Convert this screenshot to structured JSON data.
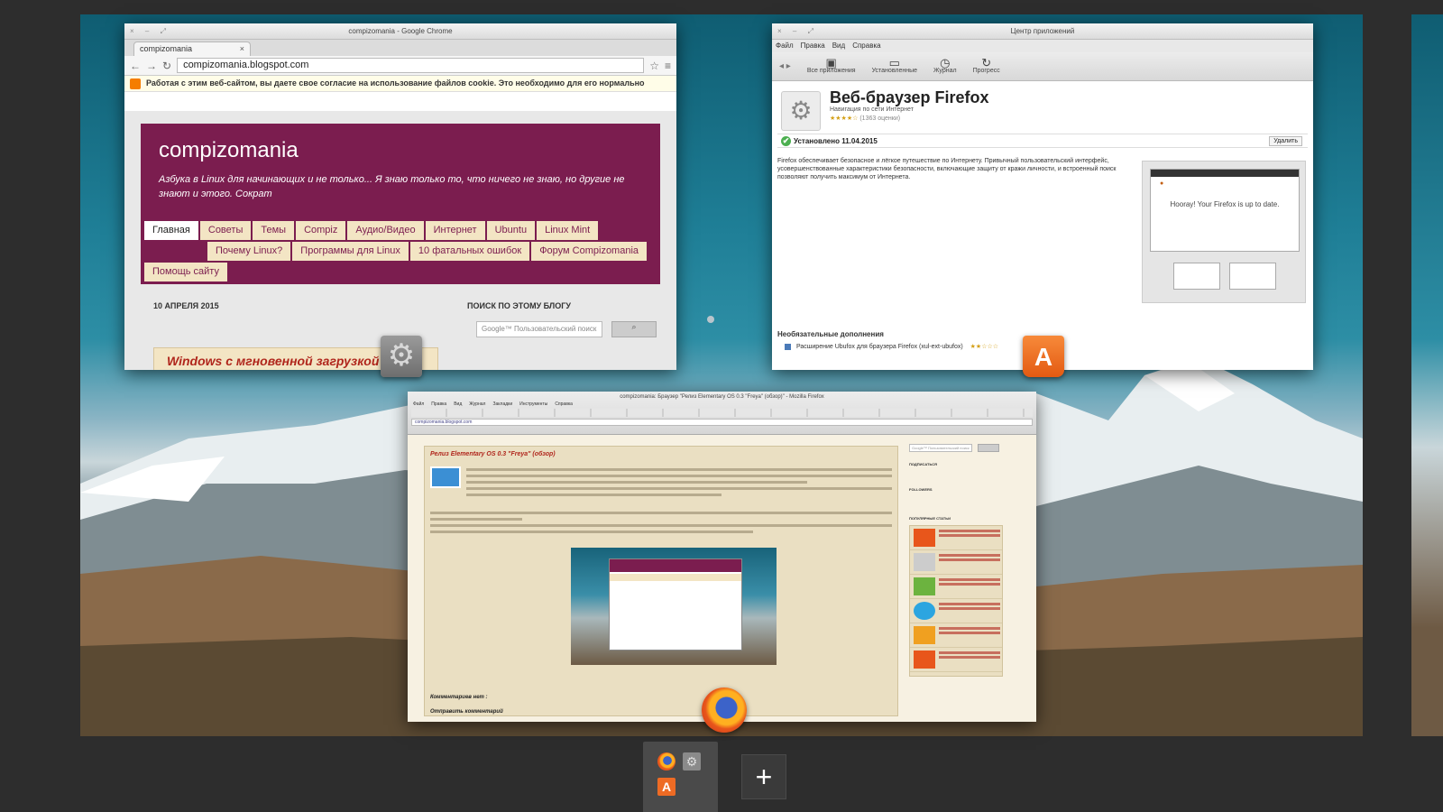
{
  "chrome": {
    "window_title": "compizomania - Google Chrome",
    "tab_label": "compizomania",
    "tab_close": "×",
    "url": "compizomania.blogspot.com",
    "cookie_notice": "Работая с этим веб-сайтом, вы даете свое согласие на использование файлов cookie. Это необходимо для его нормально",
    "blog_title": "compizomania",
    "blog_description": "Азбука в Linux для начинающих и не только... Я знаю только то, что ничего не знаю, но другие не знают и этого. Сократ",
    "nav": [
      "Главная",
      "Советы",
      "Темы",
      "Compiz",
      "Аудио/Видео",
      "Интернет",
      "Ubuntu",
      "Linux Mint",
      "Почему Linux?",
      "Программы для Linux",
      "10 фатальных ошибок",
      "Форум Compizomania",
      "Помощь сайту"
    ],
    "post_date": "10 АПРЕЛЯ 2015",
    "search_label": "ПОИСК ПО ЭТОМУ БЛОГУ",
    "search_placeholder": "Google™ Пользовательский поиск",
    "post_title": "Windows с мгновенной загрузкой"
  },
  "appcenter": {
    "window_title": "Центр приложений",
    "menu": [
      "Файл",
      "Правка",
      "Вид",
      "Справка"
    ],
    "toolbar": [
      {
        "label": "Все приложения",
        "icon": "box-icon"
      },
      {
        "label": "Установленные",
        "icon": "monitor-icon"
      },
      {
        "label": "Журнал",
        "icon": "clock-icon"
      },
      {
        "label": "Прогресс",
        "icon": "refresh-icon"
      }
    ],
    "app_name": "Веб-браузер Firefox",
    "app_subtitle": "Навигация по сети Интернет",
    "rating_stars": "★★★★☆",
    "rating_count": "(1363 оценки)",
    "installed_text": "Установлено 11.04.2015",
    "remove_button": "Удалить",
    "description": "Firefox обеспечивает безопасное и лёгкое путешествие по Интернету. Привычный пользовательский интерфейс, усовершенствованные характеристики безопасности, включающие защиту от кражи личности, и встроенный поиск позволяют получить максимум от Интернета.",
    "screenshot_text": "Hooray! Your Firefox is up to date.",
    "optional_title": "Необязательные дополнения",
    "optional_item": "Расширение Ubufox для браузера Firefox (xul-ext-ubufox)",
    "optional_stars": "★★☆☆☆"
  },
  "firefox": {
    "window_title": "compizomania: Браузер \"Релиз Elementary OS 0.3 \"Freya\" (обзор)\" - Mozilla Firefox",
    "menu": [
      "Файл",
      "Правка",
      "Вид",
      "Журнал",
      "Закладки",
      "Инструменты",
      "Справка"
    ],
    "url": "compizomania.blogspot.com",
    "post_title": "Релиз Elementary OS 0.3 \"Freya\" (обзор)",
    "comments_label": "Комментариев нет :",
    "send_comment": "Отправить комментарий",
    "side_search": "Google™ Пользовательский поиск",
    "side_subscribe": "ПОДПИСАТЬСЯ",
    "side_followers": "FOLLOWERS",
    "side_popular": "ПОПУЛЯРНЫЕ СТАТЬИ"
  },
  "dock": {
    "add_workspace": "+"
  },
  "colors": {
    "blog_accent": "#7b1d4f",
    "blog_nav_bg": "#f3e5c4",
    "store_orange": "#ee6b24",
    "desktop_bg": "#2d2d2d"
  }
}
